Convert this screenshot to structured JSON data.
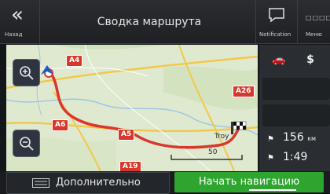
{
  "header": {
    "back_label": "Назад",
    "title": "Сводка маршрута",
    "notification_label": "Notification",
    "menu_label": "Меню"
  },
  "map": {
    "roads": [
      "A4",
      "A26",
      "A6",
      "A5",
      "A19"
    ],
    "scale_label": "50",
    "city_label": "Troy"
  },
  "route_panel": {
    "tabs": [
      "car",
      "toll"
    ],
    "distance": "156",
    "distance_unit": "км",
    "duration": "1:49"
  },
  "footer": {
    "more_label": "Дополнительно",
    "start_label": "Начать навигацию"
  },
  "colors": {
    "route": "#d9362c",
    "start_button": "#2ea52e",
    "road_badge": "#d9362c"
  }
}
